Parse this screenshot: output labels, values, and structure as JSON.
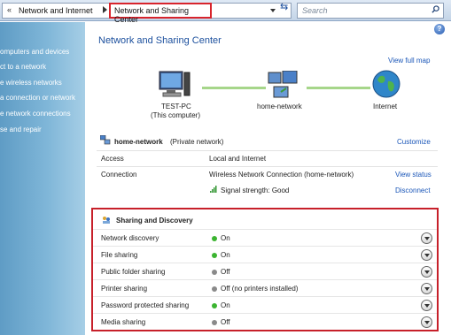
{
  "address_bar": {
    "crumb_parent": "Network and Internet",
    "crumb_current": "Network and Sharing Center",
    "search_placeholder": "Search"
  },
  "sidebar": {
    "items": [
      {
        "label": "omputers and devices"
      },
      {
        "label": "ct to a network"
      },
      {
        "label": "e wireless networks"
      },
      {
        "label": "a connection or network"
      },
      {
        "label": "e network connections"
      },
      {
        "label": "se and repair"
      }
    ]
  },
  "main": {
    "title": "Network and Sharing Center",
    "view_full_map": "View full map",
    "map": {
      "computer_name": "TEST-PC",
      "computer_sub": "(This computer)",
      "network_name": "home-network",
      "internet": "Internet"
    },
    "network": {
      "name": "home-network",
      "type": "(Private network)",
      "customize": "Customize",
      "access_label": "Access",
      "access_value": "Local and Internet",
      "connection_label": "Connection",
      "connection_value": "Wireless Network Connection (home-network)",
      "view_status": "View status",
      "signal": "Signal strength:  Good",
      "disconnect": "Disconnect"
    },
    "sharing": {
      "header": "Sharing and Discovery",
      "rows": [
        {
          "name": "Network discovery",
          "state": "On",
          "color": "#3cb431"
        },
        {
          "name": "File sharing",
          "state": "On",
          "color": "#3cb431"
        },
        {
          "name": "Public folder sharing",
          "state": "Off",
          "color": "#8a8a8a"
        },
        {
          "name": "Printer sharing",
          "state": "Off (no printers installed)",
          "color": "#8a8a8a"
        },
        {
          "name": "Password protected sharing",
          "state": "On",
          "color": "#3cb431"
        },
        {
          "name": "Media sharing",
          "state": "Off",
          "color": "#8a8a8a"
        }
      ]
    }
  }
}
